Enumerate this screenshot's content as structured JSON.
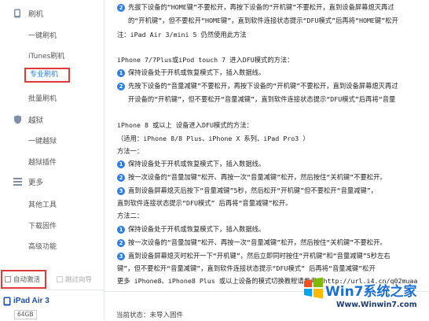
{
  "sidebar": {
    "groups": [
      {
        "label": "刷机",
        "icon": "flash-phone-icon"
      },
      {
        "label": "越狱",
        "icon": "shield-icon"
      },
      {
        "label": "更多",
        "icon": "menu-list-icon"
      }
    ],
    "flash_items": [
      "一键刷机",
      "iTunes刷机",
      "专业刷机",
      "批量刷机"
    ],
    "jailbreak_items": [
      "一键越狱",
      "越狱插件"
    ],
    "more_items": [
      "其他工具",
      "下载固件",
      "高级功能"
    ],
    "auto_activate": "自动激活",
    "skip_guide": "跳过向导",
    "device": {
      "name": "iPad Air 3",
      "storage": "64GB"
    }
  },
  "content": {
    "lines": [
      "先拔下设备的“HOME键”不要松开，再按下设备的“开机键”不要松开，直到设备屏幕熄灭再过",
      "的“开机键”，但不要松开“HOME键”，直到软件连接状态提示“DFU模式”后再将“HOME键”松开",
      "注：iPad Air 3/mini 5 仍然使用此方法",
      "iPhone 7/7Plus或iPod touch 7 进入DFU模式的方法：",
      "保持设备处于开机或恢复模式下，插入数据线。",
      "先按下设备的“音量减键”不要松开，再按下设备的“开机键”不要松开，直到设备屏幕熄灭再过",
      "开设备的“开机键”，但不要松开“音量减键”，直到软件连接状态提示“DFU模式”后再将“音量",
      "iPhone 8 或以上 设备进入DFU模式的方法：",
      "（适用：iPhone 8/8 Plus、iPhone X 系列、iPad Pro3 ）",
      "方法一：",
      "保持设备处于开机或恢复模式下，插入数据线。",
      "按一次设备的“音量加键”松开、再按一次“音量减键”松开，然后按住“关机键”不要松开。",
      "直到设备屏幕熄灭后按下“音量减键”5秒，然后松开“开机键”但不要松开“音量减键”，",
      "直到软件连接状态提示“DFU模式” 后再将“音量减键”松开。",
      "方法二：",
      "保持设备处于开机或恢复模式下，插入数据线。",
      "按一次设备的“音量加键”松开、再按一次“音量减键”松开，然后按住“关机键”不要松开。",
      "直到设备屏幕熄灭时松开一下“开机键”，然后立即同时按住“开机键”和“音量减键”5秒左右",
      "键”，但不要松开“音量减键”，直到软件连接状态提示“DFU模式” 后再将“音量减键”松开",
      "更多 iPhone8、iPhone8 Plus 或以上设备的模式切换教程请参考：http://url.i4.cn/q02muaa"
    ],
    "step_numbers": [
      "2",
      "1",
      "2",
      "1",
      "2",
      "3",
      "1",
      "2",
      "3"
    ],
    "status": "当前状态：未导入固件"
  },
  "watermark": {
    "brand": "Win7系统之家",
    "url": "Www.Winwin7.com"
  },
  "colors": {
    "accent": "#2a7de1",
    "highlight_border": "#e23a3a",
    "device_name": "#1f4fa8"
  }
}
